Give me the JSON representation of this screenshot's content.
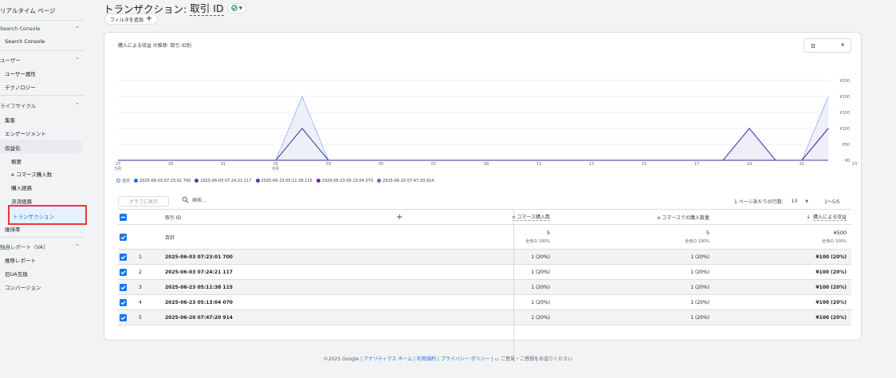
{
  "sidebar": {
    "realtime": "リアルタイム ページ",
    "sections": [
      {
        "label": "Search Console",
        "items": [
          "Search Console"
        ]
      },
      {
        "label": "ユーザー",
        "items": [
          "ユーザー属性",
          "テクノロジー"
        ]
      },
      {
        "label": "ライフサイクル",
        "items": [
          "集客",
          "エンゲージメント",
          "収益化",
          "維持率"
        ],
        "sub": [
          "概要",
          "e コマース購入数",
          "購入経路",
          "決済経路",
          "トランザクション"
        ]
      },
      {
        "label": "独自レポート（VA）",
        "items": [
          "推移レポート",
          "旧UA互換",
          "コンバージョン"
        ]
      }
    ]
  },
  "header": {
    "title_prefix": "トランザクション: ",
    "title_dim": "取引 ID",
    "add_filter": "フィルタを追加",
    "add_filter_icon": "plus-icon"
  },
  "chart": {
    "title": "購入による収益 の推移: 取引 ID別",
    "period": "日",
    "y_ticks": [
      "¥250",
      "¥200",
      "¥150",
      "¥100",
      "¥50",
      "¥0"
    ],
    "x_ticks": [
      {
        "d": "27",
        "m": "5月"
      },
      {
        "d": "29",
        "m": ""
      },
      {
        "d": "31",
        "m": ""
      },
      {
        "d": "01",
        "m": "6月"
      },
      {
        "d": "03",
        "m": ""
      },
      {
        "d": "05",
        "m": ""
      },
      {
        "d": "07",
        "m": ""
      },
      {
        "d": "09",
        "m": ""
      },
      {
        "d": "11",
        "m": ""
      },
      {
        "d": "13",
        "m": ""
      },
      {
        "d": "15",
        "m": ""
      },
      {
        "d": "17",
        "m": ""
      },
      {
        "d": "19",
        "m": ""
      },
      {
        "d": "21",
        "m": ""
      },
      {
        "d": "23",
        "m": ""
      }
    ],
    "legend": [
      "合計",
      "2025-06-03 07:23:01 700",
      "2025-06-03 07:24:21 117",
      "2025-06-23 05:11:38 115",
      "2025-06-23 05:13:04 070",
      "2025-06-20 07:47:20 914"
    ],
    "colors": {
      "total": "#4285f4",
      "s1": "#1a73e8",
      "s2": "#3949ab",
      "s3": "#5e35b1",
      "s4": "#7b1fa2",
      "s5": "#5c6bc0"
    }
  },
  "chart_data": {
    "type": "line",
    "x": [
      "5/27",
      "5/28",
      "5/29",
      "5/30",
      "5/31",
      "6/1",
      "6/2",
      "6/3",
      "6/4",
      "6/5",
      "6/6",
      "6/7",
      "6/8",
      "6/9",
      "6/10",
      "6/11",
      "6/12",
      "6/13",
      "6/14",
      "6/15",
      "6/16",
      "6/17",
      "6/18",
      "6/19",
      "6/20",
      "6/21",
      "6/22",
      "6/23"
    ],
    "series": [
      {
        "name": "合計",
        "values": [
          0,
          0,
          0,
          0,
          0,
          0,
          0,
          200,
          0,
          0,
          0,
          0,
          0,
          0,
          0,
          0,
          0,
          0,
          0,
          0,
          0,
          0,
          0,
          0,
          100,
          0,
          0,
          200
        ]
      },
      {
        "name": "2025-06-03 07:23:01 700",
        "values": [
          0,
          0,
          0,
          0,
          0,
          0,
          0,
          100,
          0,
          0,
          0,
          0,
          0,
          0,
          0,
          0,
          0,
          0,
          0,
          0,
          0,
          0,
          0,
          0,
          0,
          0,
          0,
          0
        ]
      },
      {
        "name": "2025-06-20 07:47:20 914",
        "values": [
          0,
          0,
          0,
          0,
          0,
          0,
          0,
          0,
          0,
          0,
          0,
          0,
          0,
          0,
          0,
          0,
          0,
          0,
          0,
          0,
          0,
          0,
          0,
          0,
          100,
          0,
          0,
          0
        ]
      },
      {
        "name": "2025-06-23 05:11:38 115",
        "values": [
          0,
          0,
          0,
          0,
          0,
          0,
          0,
          0,
          0,
          0,
          0,
          0,
          0,
          0,
          0,
          0,
          0,
          0,
          0,
          0,
          0,
          0,
          0,
          0,
          0,
          0,
          0,
          100
        ]
      }
    ],
    "ylim": [
      0,
      250
    ]
  },
  "toolbar": {
    "graph_btn": "グラフに表示",
    "search": "検索...",
    "rows_label": "1 ページあたりの行数:",
    "rows_value": "10",
    "range": "1〜5/5"
  },
  "table": {
    "headers": {
      "dim": "取引 ID",
      "m1": "e コマース購入数",
      "m2": "e コマースでの購入数量",
      "m3": "購入による収益"
    },
    "total": {
      "label": "合計",
      "m1": "5",
      "m1_sub": "全体の 100%",
      "m2": "5",
      "m2_sub": "全体の 100%",
      "m3": "¥500",
      "m3_sub": "全体の 100%"
    },
    "rows": [
      {
        "num": "1",
        "id": "2025-06-03 07:23:01 700",
        "m1": "1 (20%)",
        "m2": "1 (20%)",
        "m3": "¥100 (20%)"
      },
      {
        "num": "2",
        "id": "2025-06-03 07:24:21 117",
        "m1": "1 (20%)",
        "m2": "1 (20%)",
        "m3": "¥100 (20%)"
      },
      {
        "num": "3",
        "id": "2025-06-23 05:11:38 115",
        "m1": "1 (20%)",
        "m2": "1 (20%)",
        "m3": "¥100 (20%)"
      },
      {
        "num": "4",
        "id": "2025-06-23 05:13:04 070",
        "m1": "1 (20%)",
        "m2": "1 (20%)",
        "m3": "¥100 (20%)"
      },
      {
        "num": "5",
        "id": "2025-06-20 07:47:20 914",
        "m1": "1 (20%)",
        "m2": "1 (20%)",
        "m3": "¥100 (20%)"
      }
    ]
  },
  "footer": {
    "copyright": "©2025 Google | ",
    "home": "アナリティクス ホーム",
    "terms": "利用規約",
    "privacy": "プライバシー ポリシー",
    "feedback": "ご意見・ご感想をお送りください"
  }
}
